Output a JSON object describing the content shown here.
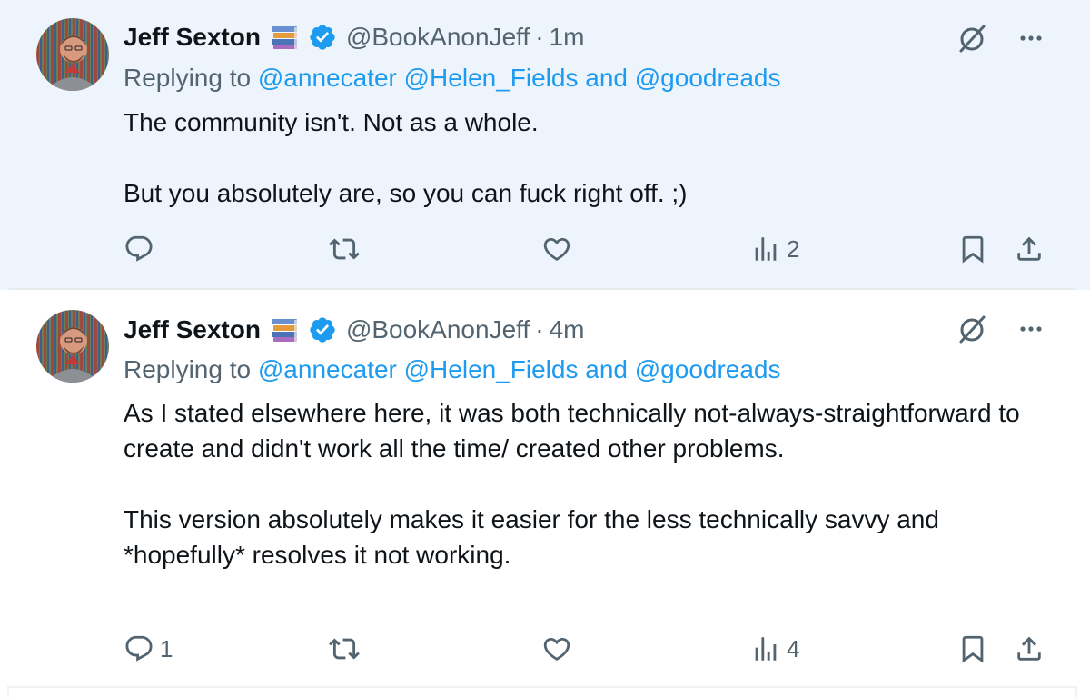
{
  "tweets": [
    {
      "author_name": "Jeff Sexton",
      "handle": "@BookAnonJeff",
      "separator": "·",
      "time": "1m",
      "replying_prefix": "Replying to",
      "mention_1": "@annecater",
      "mention_2": "@Helen_Fields",
      "mention_and": "and",
      "mention_3": "@goodreads",
      "paragraphs": [
        "The community isn't. Not as a whole.",
        "But you absolutely are, so you can fuck right off. ;)"
      ],
      "reply_count": "",
      "retweet_count": "",
      "like_count": "",
      "view_count": "2",
      "highlighted": true
    },
    {
      "author_name": "Jeff Sexton",
      "handle": "@BookAnonJeff",
      "separator": "·",
      "time": "4m",
      "replying_prefix": "Replying to",
      "mention_1": "@annecater",
      "mention_2": "@Helen_Fields",
      "mention_and": "and",
      "mention_3": "@goodreads",
      "paragraphs": [
        "As I stated elsewhere here, it was both technically not-always-straightforward to create and didn't work all the time/ created other problems.",
        "This version absolutely makes it easier for the less technically savvy and *hopefully* resolves it not working."
      ],
      "reply_count": "1",
      "retweet_count": "",
      "like_count": "",
      "view_count": "4",
      "highlighted": false
    }
  ],
  "icons": {
    "verified": "verified-badge-icon",
    "books_emoji": "books-emoji-icon",
    "grok": "grok-icon",
    "more": "more-icon",
    "reply": "reply-icon",
    "retweet": "retweet-icon",
    "like": "like-icon",
    "views": "views-icon",
    "bookmark": "bookmark-icon",
    "share": "share-icon"
  },
  "colors": {
    "accent": "#1d9bf0",
    "secondary_text": "#536471",
    "primary_text": "#0f1419",
    "highlight_bg": "#eef4fb"
  }
}
